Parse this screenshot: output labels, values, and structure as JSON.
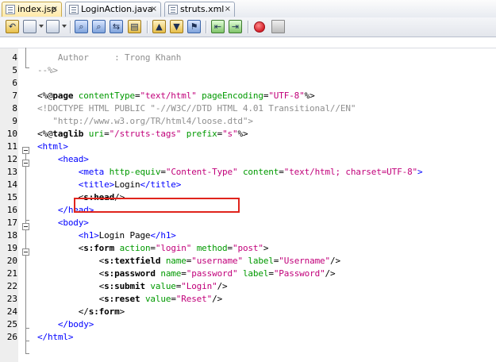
{
  "tabs": [
    {
      "label": "index.jsp",
      "close": "×",
      "active": true
    },
    {
      "label": "LoginAction.java",
      "close": "×",
      "active": false
    },
    {
      "label": "struts.xml",
      "close": "×",
      "active": false
    }
  ],
  "toolbar_icons": [
    "history-icon",
    "back-icon",
    "forward-icon",
    "find-previous-icon",
    "find-next-icon",
    "find-selection-icon",
    "toggle-highlight-icon",
    "previous-bookmark-icon",
    "next-bookmark-icon",
    "toggle-bookmark-icon",
    "shift-left-icon",
    "shift-right-icon",
    "start-macro-recording-icon",
    "stop-macro-recording-icon"
  ],
  "lines": [
    {
      "n": "4",
      "tokens": [
        {
          "c": "t-cmt",
          "t": "    Author     : Trong Khanh"
        }
      ]
    },
    {
      "n": "5",
      "tokens": [
        {
          "c": "t-cmt",
          "t": "--%>"
        }
      ]
    },
    {
      "n": "6",
      "tokens": []
    },
    {
      "n": "7",
      "tokens": [
        {
          "c": "t-plain",
          "t": "<%@"
        },
        {
          "c": "t-plain t-bold",
          "t": "page"
        },
        {
          "c": "t-attr",
          "t": " contentType"
        },
        {
          "c": "t-plain",
          "t": "="
        },
        {
          "c": "t-str",
          "t": "\"text/html\""
        },
        {
          "c": "t-attr",
          "t": " pageEncoding"
        },
        {
          "c": "t-plain",
          "t": "="
        },
        {
          "c": "t-str",
          "t": "\"UTF-8\""
        },
        {
          "c": "t-plain",
          "t": "%>"
        }
      ]
    },
    {
      "n": "8",
      "tokens": [
        {
          "c": "t-doc",
          "t": "<!DOCTYPE HTML PUBLIC \"-//W3C//DTD HTML 4.01 Transitional//EN\""
        }
      ]
    },
    {
      "n": "9",
      "tokens": [
        {
          "c": "t-doc",
          "t": "   \"http://www.w3.org/TR/html4/loose.dtd\">"
        }
      ]
    },
    {
      "n": "10",
      "tokens": [
        {
          "c": "t-plain",
          "t": "<%@"
        },
        {
          "c": "t-plain t-bold",
          "t": "taglib"
        },
        {
          "c": "t-attr",
          "t": " uri"
        },
        {
          "c": "t-plain",
          "t": "="
        },
        {
          "c": "t-str",
          "t": "\"/struts-tags\""
        },
        {
          "c": "t-attr",
          "t": " prefix"
        },
        {
          "c": "t-plain",
          "t": "="
        },
        {
          "c": "t-str",
          "t": "\"s\""
        },
        {
          "c": "t-plain",
          "t": "%>"
        }
      ]
    },
    {
      "n": "11",
      "tokens": [
        {
          "c": "t-tag",
          "t": "<html>"
        }
      ]
    },
    {
      "n": "12",
      "tokens": [
        {
          "c": "t-tag",
          "t": "    <head>"
        }
      ]
    },
    {
      "n": "13",
      "tokens": [
        {
          "c": "t-tag",
          "t": "        <meta"
        },
        {
          "c": "t-attr",
          "t": " http-equiv"
        },
        {
          "c": "t-plain",
          "t": "="
        },
        {
          "c": "t-str",
          "t": "\"Content-Type\""
        },
        {
          "c": "t-attr",
          "t": " content"
        },
        {
          "c": "t-plain",
          "t": "="
        },
        {
          "c": "t-str",
          "t": "\"text/html; charset=UTF-8\""
        },
        {
          "c": "t-tag",
          "t": ">"
        }
      ]
    },
    {
      "n": "14",
      "tokens": [
        {
          "c": "t-tag",
          "t": "        <title>"
        },
        {
          "c": "t-plain",
          "t": "Login"
        },
        {
          "c": "t-tag",
          "t": "</title>"
        }
      ]
    },
    {
      "n": "15",
      "tokens": [
        {
          "c": "t-plain",
          "t": "        <"
        },
        {
          "c": "t-plain t-bold",
          "t": "s:head"
        },
        {
          "c": "t-plain",
          "t": "/>"
        }
      ]
    },
    {
      "n": "16",
      "tokens": [
        {
          "c": "t-tag",
          "t": "    </head>"
        }
      ]
    },
    {
      "n": "17",
      "tokens": [
        {
          "c": "t-tag",
          "t": "    <body>"
        }
      ]
    },
    {
      "n": "18",
      "tokens": [
        {
          "c": "t-tag",
          "t": "        <h1>"
        },
        {
          "c": "t-plain",
          "t": "Login Page"
        },
        {
          "c": "t-tag",
          "t": "</h1>"
        }
      ]
    },
    {
      "n": "19",
      "tokens": [
        {
          "c": "t-plain",
          "t": "        <"
        },
        {
          "c": "t-plain t-bold",
          "t": "s:form"
        },
        {
          "c": "t-attr",
          "t": " action"
        },
        {
          "c": "t-plain",
          "t": "="
        },
        {
          "c": "t-str",
          "t": "\"login\""
        },
        {
          "c": "t-attr",
          "t": " method"
        },
        {
          "c": "t-plain",
          "t": "="
        },
        {
          "c": "t-str",
          "t": "\"post\""
        },
        {
          "c": "t-plain",
          "t": ">"
        }
      ]
    },
    {
      "n": "20",
      "tokens": [
        {
          "c": "t-plain",
          "t": "            <"
        },
        {
          "c": "t-plain t-bold",
          "t": "s:textfield"
        },
        {
          "c": "t-attr",
          "t": " name"
        },
        {
          "c": "t-plain",
          "t": "="
        },
        {
          "c": "t-str",
          "t": "\"username\""
        },
        {
          "c": "t-attr",
          "t": " label"
        },
        {
          "c": "t-plain",
          "t": "="
        },
        {
          "c": "t-str",
          "t": "\"Username\""
        },
        {
          "c": "t-plain",
          "t": "/>"
        }
      ]
    },
    {
      "n": "21",
      "tokens": [
        {
          "c": "t-plain",
          "t": "            <"
        },
        {
          "c": "t-plain t-bold",
          "t": "s:password"
        },
        {
          "c": "t-attr",
          "t": " name"
        },
        {
          "c": "t-plain",
          "t": "="
        },
        {
          "c": "t-str",
          "t": "\"password\""
        },
        {
          "c": "t-attr",
          "t": " label"
        },
        {
          "c": "t-plain",
          "t": "="
        },
        {
          "c": "t-str",
          "t": "\"Password\""
        },
        {
          "c": "t-plain",
          "t": "/>"
        }
      ]
    },
    {
      "n": "22",
      "tokens": [
        {
          "c": "t-plain",
          "t": "            <"
        },
        {
          "c": "t-plain t-bold",
          "t": "s:submit"
        },
        {
          "c": "t-attr",
          "t": " value"
        },
        {
          "c": "t-plain",
          "t": "="
        },
        {
          "c": "t-str",
          "t": "\"Login\""
        },
        {
          "c": "t-plain",
          "t": "/>"
        }
      ]
    },
    {
      "n": "23",
      "tokens": [
        {
          "c": "t-plain",
          "t": "            <"
        },
        {
          "c": "t-plain t-bold",
          "t": "s:reset"
        },
        {
          "c": "t-attr",
          "t": " value"
        },
        {
          "c": "t-plain",
          "t": "="
        },
        {
          "c": "t-str",
          "t": "\"Reset\""
        },
        {
          "c": "t-plain",
          "t": "/>"
        }
      ]
    },
    {
      "n": "24",
      "tokens": [
        {
          "c": "t-plain",
          "t": "        </"
        },
        {
          "c": "t-plain t-bold",
          "t": "s:form"
        },
        {
          "c": "t-plain",
          "t": ">"
        }
      ]
    },
    {
      "n": "25",
      "tokens": [
        {
          "c": "t-tag",
          "t": "    </body>"
        }
      ]
    },
    {
      "n": "26",
      "tokens": [
        {
          "c": "t-tag",
          "t": "</html>"
        }
      ]
    }
  ],
  "colors": {
    "tag": "#0000ff",
    "attribute": "#009900",
    "string": "#c1007a",
    "comment": "#8f8f8f",
    "highlight_box": "#e0241c"
  }
}
